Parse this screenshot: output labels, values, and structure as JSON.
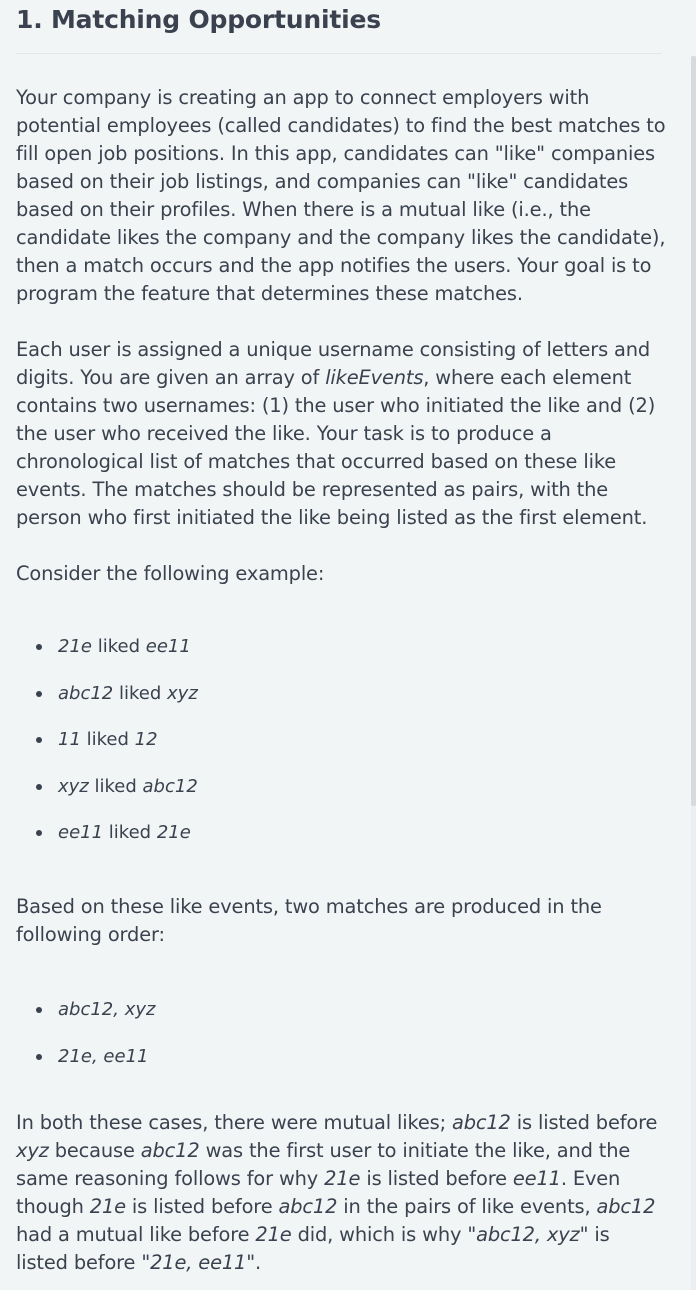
{
  "title": "1. Matching Opportunities",
  "paragraph1": "Your company is creating an app to connect employers with potential employees (called candidates) to find the best matches to fill open job positions. In this app, candidates can \"like\" companies based on their job listings, and companies can \"like\" candidates based on their profiles. When there is a mutual like (i.e., the candidate likes the company and the company likes the candidate), then a match occurs and the app notifies the users. Your goal is to program the feature that determines these matches.",
  "paragraph2": {
    "before": "Each user is assigned a unique username consisting of letters and digits. You are given an array of ",
    "term": "likeEvents",
    "after": ", where each element contains two usernames: (1) the user who initiated the like and (2) the user who received the like. Your task is to produce a chronological list of matches that occurred based on these like events. The matches should be represented as pairs, with the person who first initiated the like being listed as the first element."
  },
  "paragraph3": "Consider the following example:",
  "like_verb": "liked",
  "like_events": [
    {
      "from": "21e",
      "to": "ee11"
    },
    {
      "from": "abc12",
      "to": "xyz"
    },
    {
      "from": "11",
      "to": "12"
    },
    {
      "from": "xyz",
      "to": "abc12"
    },
    {
      "from": "ee11",
      "to": "21e"
    }
  ],
  "paragraph4": "Based on these like events, two matches are produced in the following order:",
  "matches": [
    "abc12, xyz",
    "21e, ee11"
  ],
  "paragraph5": {
    "t1": "In both these cases, there were mutual likes; ",
    "e1": "abc12",
    "t2": " is listed before ",
    "e2": "xyz",
    "t3": " because ",
    "e3": "abc12",
    "t4": " was the first user to initiate the like, and the same reasoning follows for why  ",
    "e4": "21e",
    "t5": " is listed before ",
    "e5": "ee11",
    "t6": ". Even though ",
    "e6": "21e",
    "t7": " is listed before ",
    "e7": "abc12",
    "t8": " in the pairs of like events, ",
    "e8": "abc12",
    "t9": " had a mutual like before ",
    "e9": "21e",
    "t10": " did, which is why \"",
    "e10": "abc12, xyz",
    "t11": "\" is listed before \"",
    "e11": "21e, ee11",
    "t12": "\"."
  }
}
